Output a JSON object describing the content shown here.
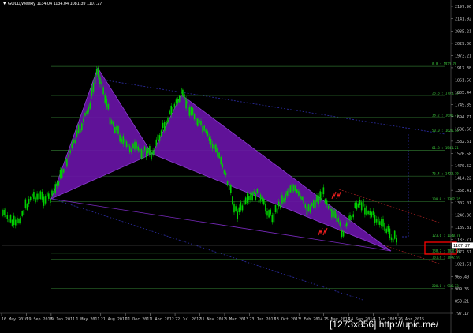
{
  "window": {
    "title_symbol": "GOLD,Weekly",
    "title_prices": "1134.04 1134.04 1081.39 1107.27"
  },
  "watermark": "[1273x856] http://upic.me/",
  "colors": {
    "background": "#000000",
    "bull_candle": "#00d000",
    "bear_candle": "#00d000",
    "pattern_fill": "#6a14a8",
    "fib_lines": "#2b6b2b",
    "fib_labels": "#3cc83c",
    "channel_lines": "#2a2a9a",
    "highlight_box": "#ff0000",
    "arrows": "#ff2020",
    "current_price_line": "#b0b0b0"
  },
  "chart_data": {
    "type": "candlestick",
    "timeframe": "Weekly",
    "symbol": "GOLD",
    "price_axis_ticks": [
      "2197.96",
      "2141.92",
      "2085.21",
      "2029.00",
      "1973.21",
      "1917.38",
      "1861.50",
      "1805.44",
      "1749.39",
      "1694.71",
      "1638.66",
      "1582.61",
      "1526.58",
      "1470.52",
      "1414.22",
      "1358.41",
      "1302.01",
      "1246.36",
      "1189.81",
      "1133.71",
      "1077.61",
      "1021.51",
      "965.40",
      "909.35",
      "853.21",
      "797.17"
    ],
    "price_axis_range": [
      797.17,
      2197.96
    ],
    "current_price_label": "1107.27",
    "date_axis_ticks": [
      "16 May 2010",
      "19 Sep 2010",
      "9 Jan 2011",
      "1 May 2011",
      "21 Aug 2011",
      "11 Dec 2011",
      "1 Apr 2012",
      "22 Jul 2012",
      "11 Nov 2012",
      "3 Mar 2013",
      "23 Jun 2013",
      "13 Oct 2013",
      "2 Feb 2014",
      "25 May 2014",
      "14 Sep 2014",
      "4 Jan 2015",
      "26 Apr 2015"
    ],
    "fib_levels": [
      {
        "label": "0.0 : 1923.70",
        "price": 1923.7
      },
      {
        "label": "23.6 : 1791.15",
        "price": 1791.15
      },
      {
        "label": "38.2 : 1690.77",
        "price": 1690.77
      },
      {
        "label": "50.0 : 1620.53",
        "price": 1620.53
      },
      {
        "label": "61.8 : 1541.21",
        "price": 1541.21
      },
      {
        "label": "76.4 : 1423.10",
        "price": 1423.1
      },
      {
        "label": "100.0 : 1307.35",
        "price": 1307.35
      },
      {
        "label": "123.6 : 1140.70",
        "price": 1140.7
      },
      {
        "label": "138.2 : 1071.10",
        "price": 1071.1
      },
      {
        "label": "161.8 : 1042.91",
        "price": 1042.91
      },
      {
        "label": "200.0 : 910.33",
        "price": 910.33
      }
    ],
    "series": [
      {
        "values": []
      }
    ]
  }
}
